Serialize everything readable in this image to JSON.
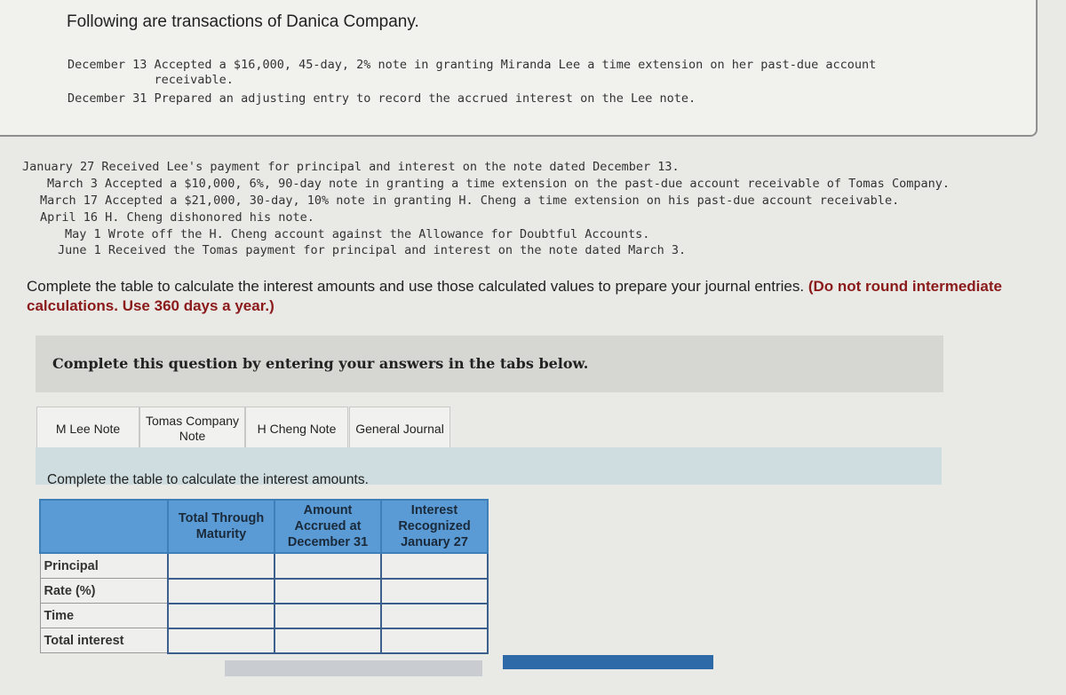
{
  "title": "Following are transactions of Danica Company.",
  "box_lines": [
    "December 13 Accepted a $16,000, 45-day, 2% note in granting Miranda Lee a time extension on her past-due account",
    "            receivable.",
    "December 31 Prepared an adjusting entry to record the accrued interest on the Lee note."
  ],
  "lines": [
    "January 27 Received Lee's payment for principal and interest on the note dated December 13.",
    "March 3 Accepted a $10,000, 6%, 90-day note in granting a time extension on the past-due account receivable of Tomas Company.",
    "March 17 Accepted a $21,000, 30-day, 10% note in granting H. Cheng a time extension on his past-due account receivable.",
    "April 16 H. Cheng dishonored his note.",
    "May 1 Wrote off the H. Cheng account against the Allowance for Doubtful Accounts.",
    "June 1 Received the Tomas payment for principal and interest on the note dated March 3."
  ],
  "instruction": "Complete the table to calculate the interest amounts and use those calculated values to prepare your journal entries.",
  "instruction_bold": "(Do not round intermediate calculations. Use 360 days a year.)",
  "question_bar": "Complete this question by entering your answers in the tabs below.",
  "tabs": [
    "M Lee Note",
    "Tomas Company Note",
    "H Cheng Note",
    "General Journal"
  ],
  "sub_instruction": "Complete the table to calculate the interest amounts.",
  "table": {
    "headers": [
      "",
      "Total Through Maturity",
      "Amount Accrued at December 31",
      "Interest Recognized January 27"
    ],
    "rows": [
      "Principal",
      "Rate (%)",
      "Time",
      "Total interest"
    ]
  }
}
